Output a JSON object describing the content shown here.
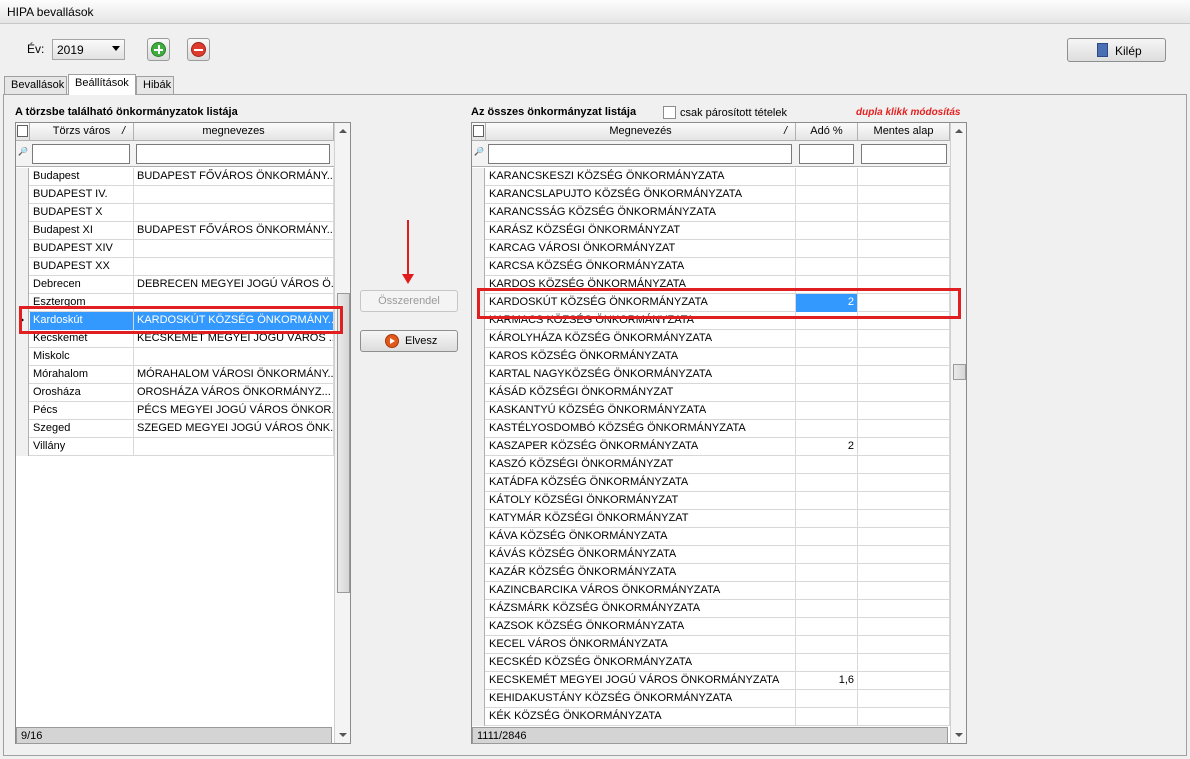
{
  "window": {
    "title": "HIPA bevallások"
  },
  "toolbar": {
    "year_label": "Év:",
    "year_value": "2019",
    "exit_label": "Kilép"
  },
  "tabs": [
    "Bevallások",
    "Beállítások",
    "Hibák"
  ],
  "left": {
    "title": "A törzsbe található önkormányzatok listája",
    "col_city": "Törzs város",
    "col_name": "megnevezes",
    "rows": [
      [
        "Budapest",
        "BUDAPEST FŐVÁROS ÖNKORMÁNY..."
      ],
      [
        "BUDAPEST IV.",
        ""
      ],
      [
        "BUDAPEST X",
        ""
      ],
      [
        "Budapest XI",
        "BUDAPEST FŐVÁROS ÖNKORMÁNY..."
      ],
      [
        "BUDAPEST XIV",
        ""
      ],
      [
        "BUDAPEST XX",
        ""
      ],
      [
        "Debrecen",
        "DEBRECEN MEGYEI JOGÚ VÁROS Ö..."
      ],
      [
        "Esztergom",
        ""
      ],
      [
        "Kardoskút",
        "KARDOSKÚT KÖZSÉG ÖNKORMÁNY..."
      ],
      [
        "Kecskemét",
        "KECSKEMÉT MEGYEI JOGÚ VÁROS ..."
      ],
      [
        "Miskolc",
        ""
      ],
      [
        "Mórahalom",
        "MÓRAHALOM VÁROSI ÖNKORMÁNY..."
      ],
      [
        "Orosháza",
        "OROSHÁZA VÁROS ÖNKORMÁNYZ..."
      ],
      [
        "Pécs",
        "PÉCS MEGYEI JOGÚ VÁROS ÖNKOR..."
      ],
      [
        "Szeged",
        "SZEGED MEGYEI JOGÚ VÁROS ÖNK..."
      ],
      [
        "Villány",
        ""
      ]
    ],
    "footer": "9/16"
  },
  "middle": {
    "assign_label": "Összerendel",
    "remove_label": "Elvesz"
  },
  "right": {
    "title": "Az összes önkormányzat listája",
    "checkbox_label": "csak párosított tételek",
    "note": "dupla klikk módosítás",
    "col_name": "Megnevezés",
    "col_tax": "Adó %",
    "col_exempt": "Mentes alap",
    "rows": [
      [
        "KARANCSKESZI KÖZSÉG ÖNKORMÁNYZATA",
        ""
      ],
      [
        "KARANCSLAPUJTO KÖZSÉG ÖNKORMÁNYZATA",
        ""
      ],
      [
        "KARANCSSÁG KÖZSÉG ÖNKORMÁNYZATA",
        ""
      ],
      [
        "KARÁSZ KÖZSÉGI ÖNKORMÁNYZAT",
        ""
      ],
      [
        "KARCAG VÁROSI ÖNKORMÁNYZAT",
        ""
      ],
      [
        "KARCSA KÖZSÉG ÖNKORMÁNYZATA",
        ""
      ],
      [
        "KARDOS KÖZSÉG ÖNKORMÁNYZATA",
        ""
      ],
      [
        "KARDOSKÚT KÖZSÉG ÖNKORMÁNYZATA",
        "2"
      ],
      [
        "KARMACS KÖZSÉG ÖNKORMÁNYZATA",
        ""
      ],
      [
        "KÁROLYHÁZA KÖZSÉG ÖNKORMÁNYZATA",
        ""
      ],
      [
        "KAROS KÖZSÉG ÖNKORMÁNYZATA",
        ""
      ],
      [
        "KARTAL NAGYKÖZSÉG ÖNKORMÁNYZATA",
        ""
      ],
      [
        "KÁSÁD KÖZSÉGI ÖNKORMÁNYZAT",
        ""
      ],
      [
        "KASKANTYÚ KÖZSÉG ÖNKORMÁNYZATA",
        ""
      ],
      [
        "KASTÉLYOSDOMBÓ KÖZSÉG ÖNKORMÁNYZATA",
        ""
      ],
      [
        "KASZAPER KÖZSÉG ÖNKORMÁNYZATA",
        "2"
      ],
      [
        "KASZÓ KÖZSÉGI ÖNKORMÁNYZAT",
        ""
      ],
      [
        "KATÁDFA KÖZSÉG ÖNKORMÁNYZATA",
        ""
      ],
      [
        "KÁTOLY KÖZSÉGI ÖNKORMÁNYZAT",
        ""
      ],
      [
        "KATYMÁR KÖZSÉGI ÖNKORMÁNYZAT",
        ""
      ],
      [
        "KÁVA KÖZSÉG ÖNKORMÁNYZATA",
        ""
      ],
      [
        "KÁVÁS KÖZSÉG ÖNKORMÁNYZATA",
        ""
      ],
      [
        "KAZÁR KÖZSÉG ÖNKORMÁNYZATA",
        ""
      ],
      [
        "KAZINCBARCIKA VÁROS ÖNKORMÁNYZATA",
        ""
      ],
      [
        "KÁZSMÁRK KÖZSÉG ÖNKORMÁNYZATA",
        ""
      ],
      [
        "KAZSOK KÖZSÉG ÖNKORMÁNYZATA",
        ""
      ],
      [
        "KECEL VÁROS ÖNKORMÁNYZATA",
        ""
      ],
      [
        "KECSKÉD KÖZSÉG ÖNKORMÁNYZATA",
        ""
      ],
      [
        "KECSKEMÉT MEGYEI JOGÚ VÁROS ÖNKORMÁNYZATA",
        "1,6"
      ],
      [
        "KEHIDAKUSTÁNY KÖZSÉG ÖNKORMÁNYZATA",
        ""
      ],
      [
        "KÉK KÖZSÉG ÖNKORMÁNYZATA",
        ""
      ]
    ],
    "footer": "1111/2846"
  },
  "colors": {
    "selection": "#3399ff",
    "highlight": "#e02020"
  }
}
